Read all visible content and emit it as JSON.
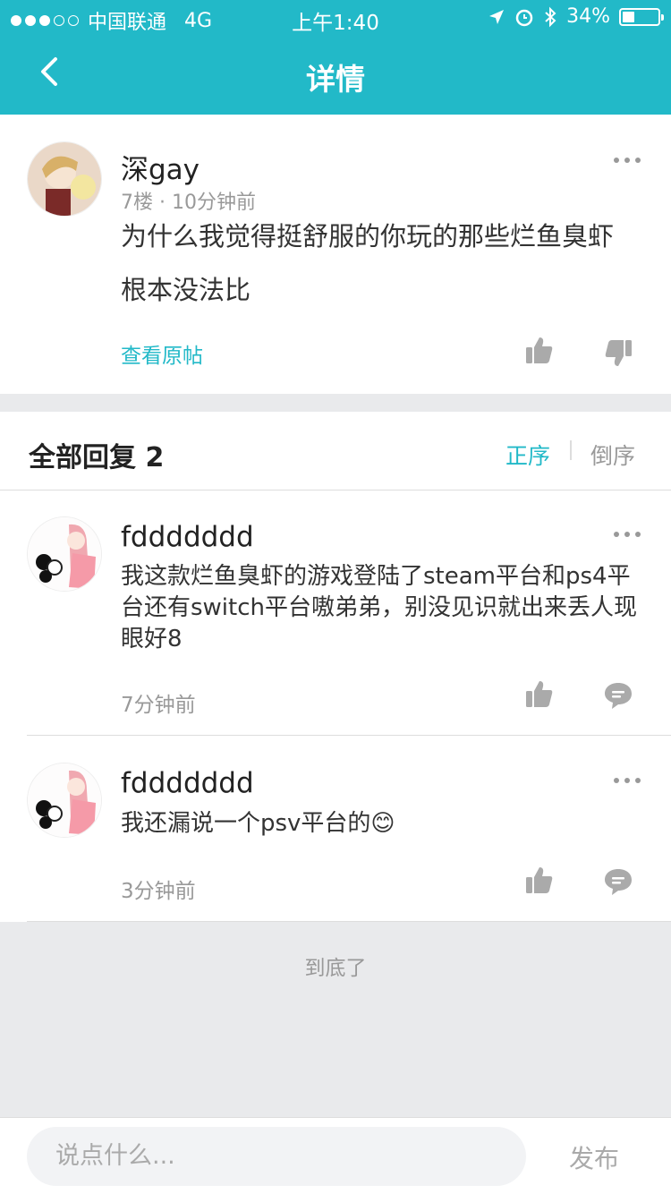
{
  "status_bar": {
    "carrier": "中国联通",
    "network": "4G",
    "time": "上午1:40",
    "battery": "34%",
    "battery_level": 0.34
  },
  "nav": {
    "title": "详情"
  },
  "post": {
    "author": "深gay",
    "meta": "7楼 · 10分钟前",
    "content": "为什么我觉得挺舒服的你玩的那些烂鱼臭虾根本没法比",
    "view_original": "查看原帖"
  },
  "replies_header": {
    "title": "全部回复 2",
    "sort_asc": "正序",
    "sort_desc": "倒序"
  },
  "replies": [
    {
      "author": "fddddddd",
      "content": "我这款烂鱼臭虾的游戏登陆了steam平台和ps4平台还有switch平台嗷弟弟，别没见识就出来丢人现眼好8",
      "time": "7分钟前"
    },
    {
      "author": "fddddddd",
      "content": "我还漏说一个psv平台的😊",
      "time": "3分钟前"
    }
  ],
  "end_text": "到底了",
  "composer": {
    "placeholder": "说点什么...",
    "publish_label": "发布"
  },
  "colors": {
    "accent": "#22b9c8",
    "muted": "#999999"
  }
}
